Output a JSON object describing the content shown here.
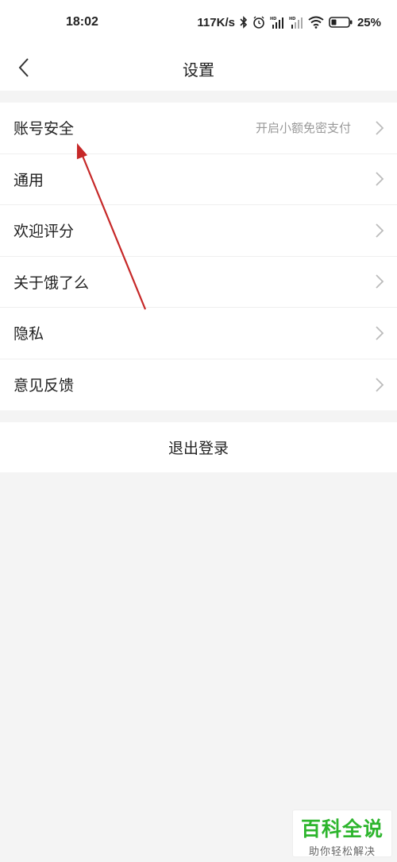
{
  "status_bar": {
    "time": "18:02",
    "net_speed": "117K/s",
    "battery": "25%",
    "icons": [
      "bluetooth-icon",
      "alarm-icon",
      "signal-hd-icon",
      "signal-hd-icon",
      "wifi-icon",
      "battery-icon"
    ]
  },
  "nav": {
    "title": "设置",
    "back_icon": "chevron-left-icon"
  },
  "menu": {
    "items": [
      {
        "label": "账号安全",
        "hint": "开启小额免密支付"
      },
      {
        "label": "通用"
      },
      {
        "label": "欢迎评分"
      },
      {
        "label": "关于饿了么"
      },
      {
        "label": "隐私"
      },
      {
        "label": "意见反馈"
      }
    ]
  },
  "logout": {
    "label": "退出登录"
  },
  "watermark": {
    "main": "百科全说",
    "sub": "助你轻松解决"
  },
  "colors": {
    "page_bg": "#f4f4f4",
    "card_bg": "#ffffff",
    "hint_text": "#999999",
    "annotation_arrow": "#c62828",
    "watermark_green": "#2db52d"
  }
}
